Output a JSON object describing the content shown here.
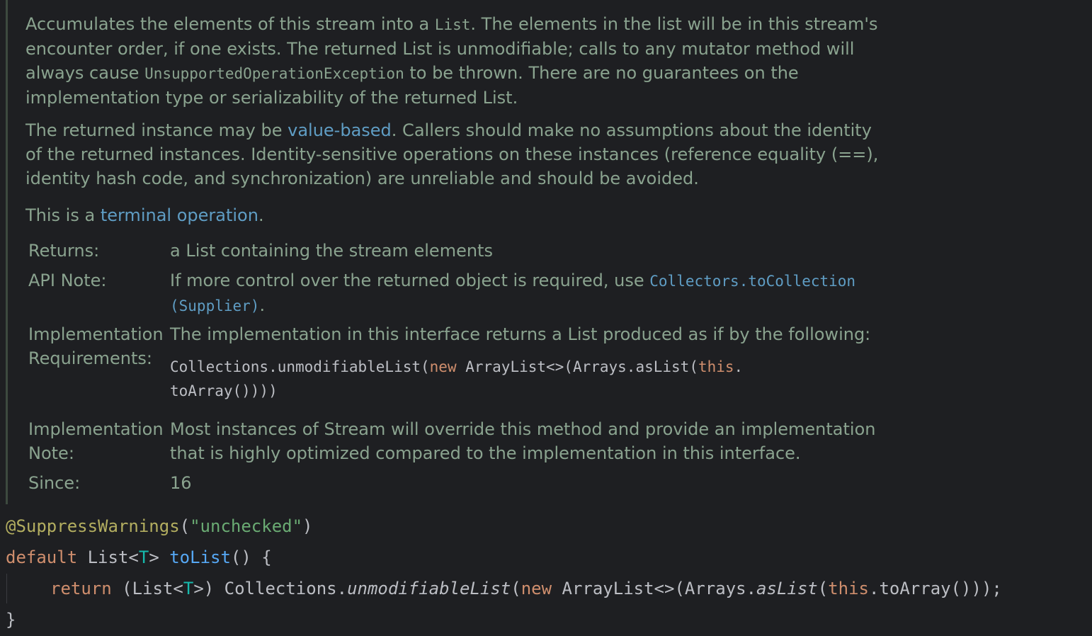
{
  "doc": {
    "p1": {
      "t1": "Accumulates the elements of this stream into a ",
      "c1": "List",
      "t2": ". The elements in the list will be in this stream's",
      "t3": "encounter order, if one exists. The returned List is unmodifiable; calls to any mutator method will",
      "t4": "always cause ",
      "c2": "UnsupportedOperationException",
      "t5": " to be thrown. There are no guarantees on the",
      "t6": "implementation type or serializability of the returned List."
    },
    "p2": {
      "t1": "The returned instance may be ",
      "link": "value-based",
      "t2": ". Callers should make no assumptions about the identity",
      "t3": "of the returned instances. Identity-sensitive operations on these instances (reference equality (==),",
      "t4": "identity hash code, and synchronization) are unreliable and should be avoided."
    },
    "p3": {
      "t1": "This is a ",
      "link": "terminal operation",
      "t2": "."
    },
    "tags": {
      "returns_label": "Returns:",
      "returns_value": "a List containing the stream elements",
      "api_label": "API Note:",
      "api_text": "If more control over the returned object is required, use ",
      "api_link1": "Collectors.toCollection",
      "api_link2": "(Supplier)",
      "api_dot": ".",
      "impl_req_label1": "Implementation",
      "impl_req_label2": "Requirements:",
      "impl_req_text": "The implementation in this interface returns a List produced as if by the following:",
      "impl_req_code_a": " Collections.unmodifiableList(",
      "impl_req_code_new": "new",
      "impl_req_code_b": " ArrayList<>(Arrays.asList(",
      "impl_req_code_this": "this",
      "impl_req_code_c": ".",
      "impl_req_code_d": "toArray()))",
      "impl_req_code_e": ")",
      "impl_note_label1": "Implementation",
      "impl_note_label2": "Note:",
      "impl_note_line1": "Most instances of Stream will override this method and provide an implementation",
      "impl_note_line2": "that is highly optimized compared to the implementation in this interface.",
      "since_label": "Since:",
      "since_value": "16"
    }
  },
  "code": {
    "annotation": "@SuppressWarnings",
    "ann_open": "(",
    "ann_string": "\"unchecked\"",
    "ann_close": ")",
    "default_kw": "default",
    "sig_a": " List<",
    "type_param": "T",
    "sig_b": "> ",
    "method_name": "toList",
    "sig_c": "() {",
    "return_kw": "return",
    "ret_a": " (List<",
    "ret_type": "T",
    "ret_b": ">) Collections.",
    "unmod": "unmodifiableList",
    "ret_c": "(",
    "new_kw": "new",
    "ret_d": " ArrayList<>(Arrays.",
    "aslist": "asList",
    "ret_e": "(",
    "this_kw": "this",
    "ret_f": ".toArray()));",
    "close_brace": "}"
  },
  "colors": {
    "background": "#1e1f22",
    "doc_text": "#8aa38f",
    "doc_link": "#5f9dc4",
    "keyword": "#cf8e6d",
    "annotation": "#b3ae60",
    "string": "#6aab73",
    "type_param": "#16baac",
    "method_decl": "#56a8f5",
    "code_text": "#bcbec4"
  }
}
